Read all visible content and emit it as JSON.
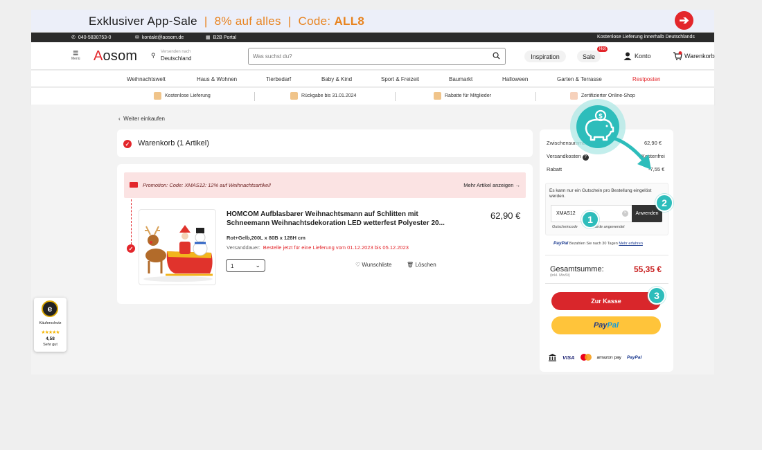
{
  "banner": {
    "title": "Exklusiver App-Sale",
    "separator": "|",
    "discount": "8% auf alles",
    "code_label": "Code: ",
    "code_value": "ALL8",
    "arrow_icon": "arrow-right-icon"
  },
  "topbar": {
    "phone": "040-5830753-0",
    "email": "kontakt@aosom.de",
    "b2b": "B2B Portal",
    "shipping_note": "Kostenlose Lieferung innerhalb Deutschlands"
  },
  "header": {
    "menu_label": "Menü",
    "logo_first": "A",
    "logo_rest": "osom",
    "ship_label": "Versenden nach",
    "ship_value": "Deutschland",
    "search_placeholder": "Was suchst du?",
    "inspiration": "Inspiration",
    "sale": "Sale",
    "hot": "Hot",
    "account": "Konto",
    "cart": "Warenkorb",
    "cart_count": "1"
  },
  "nav": {
    "items": [
      "Weihnachtswelt",
      "Haus & Wohnen",
      "Tierbedarf",
      "Baby & Kind",
      "Sport & Freizeit",
      "Baumarkt",
      "Halloween",
      "Garten & Terrasse",
      "Restposten"
    ]
  },
  "usp": {
    "items": [
      "Kostenlose Lieferung",
      "Rückgabe bis 31.01.2024",
      "Rabatte für Mitglieder",
      "Zertifizierter Online-Shop"
    ]
  },
  "cart": {
    "back": "Weiter einkaufen",
    "title": "Warenkorb (1 Artikel)",
    "promo_text": "Promotion: Code: XMAS12: 12% auf Weihnachtsartikel!",
    "promo_more": "Mehr Artikel anzeigen",
    "product": {
      "name": "HOMCOM Aufblasbarer Weihnachtsmann auf Schlitten mit Schneemann Weihnachtsdekoration LED wetterfest Polyester 20...",
      "price": "62,90 €",
      "variant": "Rot+Gelb,200L x 80B x 128H cm",
      "delivery_label": "Versanddauer:",
      "delivery_value": "Bestelle jetzt für eine Lieferung vom 01.12.2023 bis 05.12.2023",
      "quantity": "1",
      "wishlist": "Wunschliste",
      "delete": "Löschen"
    }
  },
  "summary": {
    "subtotal_label": "Zwischensumme",
    "subtotal_value": "62,90 €",
    "shipping_label": "Versandkosten",
    "shipping_value": "Kostenfrei",
    "discount_label": "Rabatt",
    "discount_value": "-7,55 €",
    "coupon_note": "Es kann nur ein Gutschein pro Bestellung eingelöst werden.",
    "coupon_value": "XMAS12",
    "apply": "Anwenden",
    "coupon_msg_prefix": "Gutscheincode",
    "coupon_msg_suffix": "wurde angewendet",
    "paypal_brand": "PayPal",
    "paypal_text": "Bezahlen Sie nach 30 Tagen",
    "paypal_link": "Mehr erfahren",
    "total_label": "Gesamtsumme:",
    "total_sub": "(inkl. MwSt)",
    "total_value": "55,35 €",
    "checkout": "Zur Kasse",
    "paypal_btn_1": "Pay",
    "paypal_btn_2": "Pal",
    "pay_methods": [
      "VISA",
      "amazon pay",
      "PayPal"
    ]
  },
  "annotations": {
    "steps": [
      "1",
      "2",
      "3"
    ]
  },
  "trust": {
    "label": "Käuferschutz",
    "rating": "4,58",
    "rating_text": "Sehr gut"
  },
  "colors": {
    "brand_red": "#e3262b",
    "accent_orange": "#e8831e",
    "annotation_teal": "#2dbdbb",
    "paypal_yellow": "#ffc43a"
  }
}
